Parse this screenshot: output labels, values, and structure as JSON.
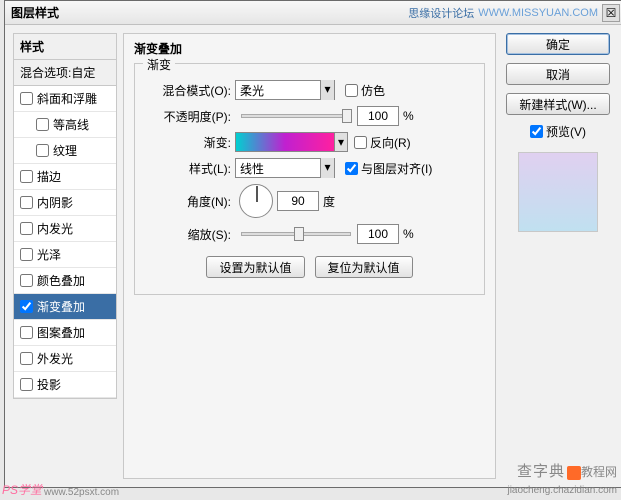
{
  "titlebar": {
    "title": "图层样式",
    "forum_text": "思缘设计论坛",
    "forum_url": "WWW.MISSYUAN.COM"
  },
  "left": {
    "header": "样式",
    "subheader": "混合选项:自定",
    "items": [
      {
        "label": "斜面和浮雕",
        "checked": false,
        "indent": false,
        "selected": false
      },
      {
        "label": "等高线",
        "checked": false,
        "indent": true,
        "selected": false
      },
      {
        "label": "纹理",
        "checked": false,
        "indent": true,
        "selected": false
      },
      {
        "label": "描边",
        "checked": false,
        "indent": false,
        "selected": false
      },
      {
        "label": "内阴影",
        "checked": false,
        "indent": false,
        "selected": false
      },
      {
        "label": "内发光",
        "checked": false,
        "indent": false,
        "selected": false
      },
      {
        "label": "光泽",
        "checked": false,
        "indent": false,
        "selected": false
      },
      {
        "label": "颜色叠加",
        "checked": false,
        "indent": false,
        "selected": false
      },
      {
        "label": "渐变叠加",
        "checked": true,
        "indent": false,
        "selected": true
      },
      {
        "label": "图案叠加",
        "checked": false,
        "indent": false,
        "selected": false
      },
      {
        "label": "外发光",
        "checked": false,
        "indent": false,
        "selected": false
      },
      {
        "label": "投影",
        "checked": false,
        "indent": false,
        "selected": false
      }
    ]
  },
  "center": {
    "title": "渐变叠加",
    "fieldset_title": "渐变",
    "blend_label": "混合模式(O):",
    "blend_value": "柔光",
    "dither_label": "仿色",
    "opacity_label": "不透明度(P):",
    "opacity_value": "100",
    "gradient_label": "渐变:",
    "reverse_label": "反向(R)",
    "style_label": "样式(L):",
    "style_value": "线性",
    "align_label": "与图层对齐(I)",
    "angle_label": "角度(N):",
    "angle_value": "90",
    "angle_unit": "度",
    "scale_label": "缩放(S):",
    "scale_value": "100",
    "pct": "%",
    "defaults_set": "设置为默认值",
    "defaults_reset": "复位为默认值"
  },
  "right": {
    "ok": "确定",
    "cancel": "取消",
    "newstyle": "新建样式(W)...",
    "preview": "预览(V)"
  },
  "watermark": {
    "bl": "PS学堂",
    "bl2": "www.52psxt.com",
    "br_zh": "查字典",
    "br_sub": "教程网",
    "br_py": "jiaocheng.chazidian.com"
  }
}
